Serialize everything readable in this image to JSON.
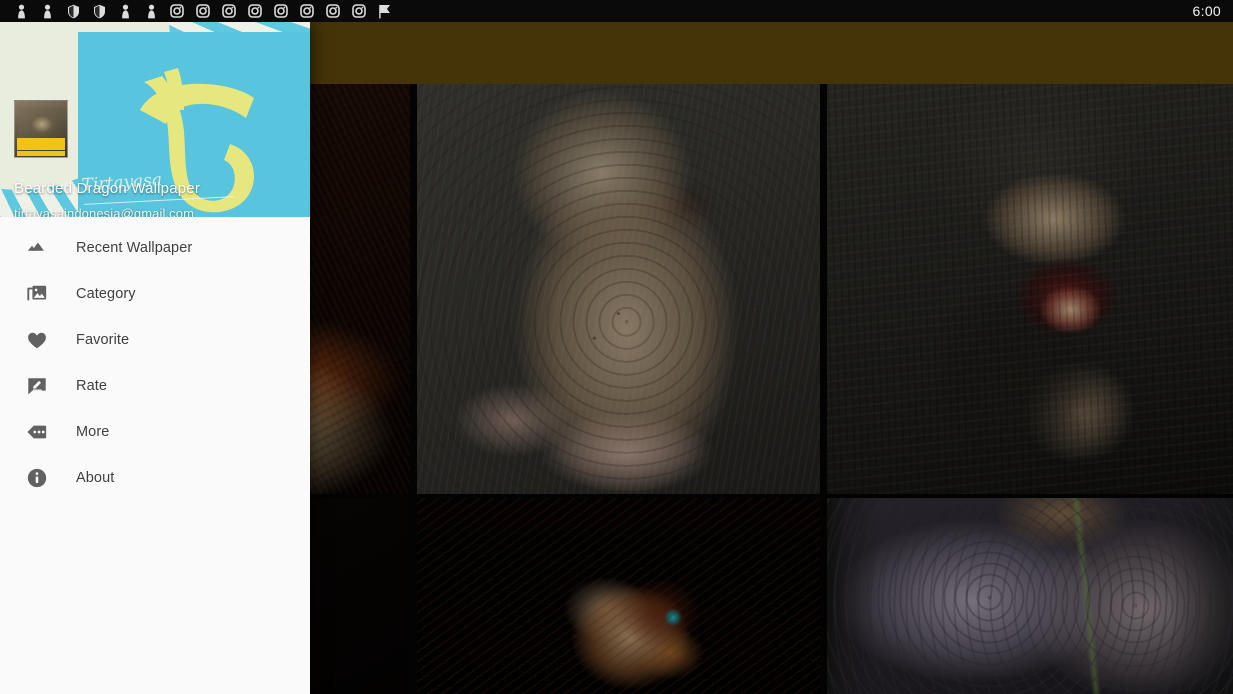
{
  "status_bar": {
    "clock": "6:00",
    "icons": [
      {
        "name": "notification-person-icon",
        "glyph": "person"
      },
      {
        "name": "notification-person-icon",
        "glyph": "person"
      },
      {
        "name": "notification-shield-icon",
        "glyph": "shield"
      },
      {
        "name": "notification-shield-icon",
        "glyph": "shield"
      },
      {
        "name": "notification-person-icon",
        "glyph": "person"
      },
      {
        "name": "notification-person-icon",
        "glyph": "person"
      },
      {
        "name": "notification-camera-icon",
        "glyph": "camera"
      },
      {
        "name": "notification-camera-icon",
        "glyph": "camera"
      },
      {
        "name": "notification-camera-icon",
        "glyph": "camera"
      },
      {
        "name": "notification-camera-icon",
        "glyph": "camera"
      },
      {
        "name": "notification-camera-icon",
        "glyph": "camera"
      },
      {
        "name": "notification-camera-icon",
        "glyph": "camera"
      },
      {
        "name": "notification-camera-icon",
        "glyph": "camera"
      },
      {
        "name": "notification-camera-icon",
        "glyph": "camera"
      },
      {
        "name": "notification-flag-icon",
        "glyph": "flag"
      }
    ]
  },
  "toolbar": {
    "title": "",
    "background_color": "#6b520d"
  },
  "drawer": {
    "header": {
      "app_name": "Bearded Dragon Wallpaper",
      "email": "tirtayasaindonesia@gmail.com",
      "script_mark": "Tirtayasa",
      "accent_color": "#58c4dd",
      "logo_color": "#e6e77e"
    },
    "items": [
      {
        "label": "Recent Wallpaper",
        "icon": "landscape-icon"
      },
      {
        "label": "Category",
        "icon": "photo-library-icon"
      },
      {
        "label": "Favorite",
        "icon": "heart-icon"
      },
      {
        "label": "Rate",
        "icon": "rate-review-icon"
      },
      {
        "label": "More",
        "icon": "more-tag-icon"
      },
      {
        "label": "About",
        "icon": "info-icon"
      }
    ]
  },
  "grid": {
    "rows": [
      {
        "cells": [
          {
            "name": "wallpaper-thumb-1",
            "alt": "Dark red bearded dragon on branch"
          },
          {
            "name": "wallpaper-thumb-2",
            "alt": "Tan spiky bearded dragon on grey background"
          },
          {
            "name": "wallpaper-thumb-3",
            "alt": "Bearded dragon with open mouth"
          }
        ]
      },
      {
        "cells": [
          {
            "name": "wallpaper-thumb-4",
            "alt": "Dark close-up of bearded dragon scales"
          },
          {
            "name": "wallpaper-thumb-5",
            "alt": "Orange lizard head with teal eye on black"
          },
          {
            "name": "wallpaper-thumb-6",
            "alt": "Lavender scaly bearded dragon close-up"
          }
        ]
      }
    ]
  }
}
